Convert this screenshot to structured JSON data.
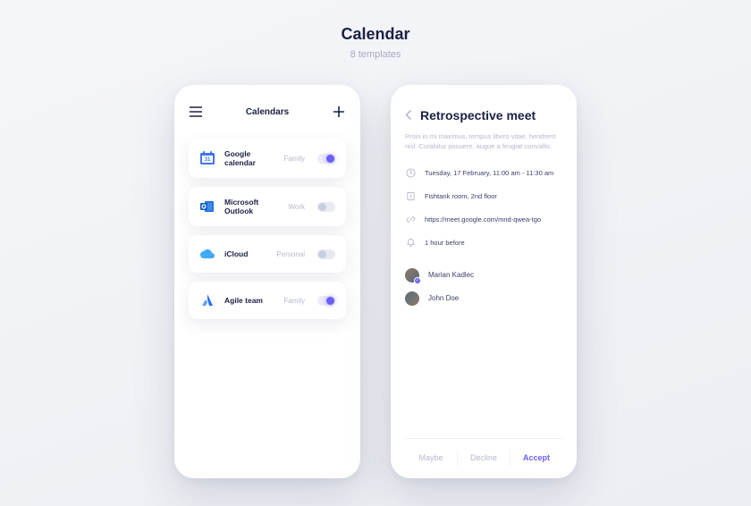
{
  "header": {
    "title": "Calendar",
    "subtitle": "8 templates"
  },
  "screen1": {
    "title": "Calendars",
    "items": [
      {
        "name": "Google calendar",
        "tag": "Family",
        "on": true,
        "icon": "google-calendar"
      },
      {
        "name": "Microsoft Outlook",
        "tag": "Work",
        "on": false,
        "icon": "outlook"
      },
      {
        "name": "iCloud",
        "tag": "Personal",
        "on": false,
        "icon": "icloud"
      },
      {
        "name": "Agile team",
        "tag": "Family",
        "on": true,
        "icon": "atlassian"
      }
    ]
  },
  "screen2": {
    "title": "Retrospective meet",
    "description": "Proin in mi maximus, tempus libero vitae, hendrerit nisl. Curabitur posuere, augue a feugiat convallis.",
    "info": {
      "time": "Tuesday, 17 February, 11:00 am - 11:30 am",
      "location": "Fishtank room, 2nd floor",
      "link": "https://meet.google.com/mnd-qwea-tgo",
      "reminder": "1 hour before"
    },
    "attendees": [
      {
        "name": "Marian Kadlec",
        "organizer": true
      },
      {
        "name": "John Doe",
        "organizer": false
      }
    ],
    "actions": {
      "maybe": "Maybe",
      "decline": "Decline",
      "accept": "Accept"
    }
  }
}
